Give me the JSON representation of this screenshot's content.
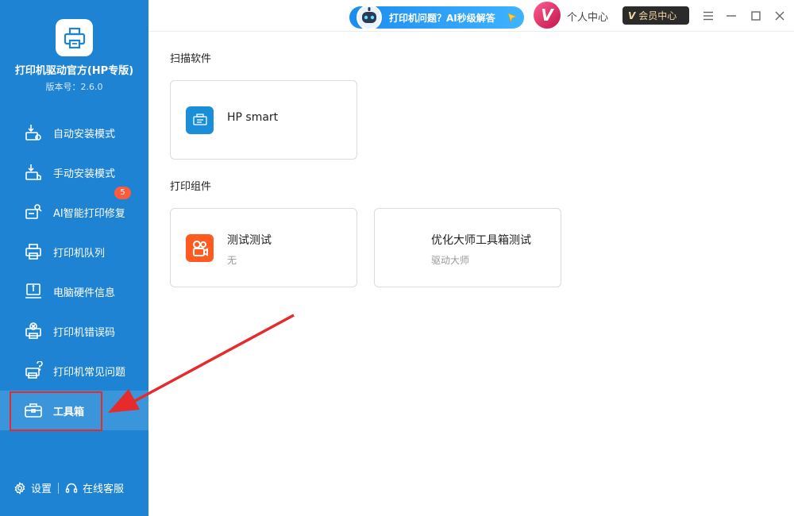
{
  "app": {
    "title": "打印机驱动官方(HP专版)",
    "version": "版本号：2.6.0"
  },
  "nav": {
    "items": [
      {
        "label": "自动安装模式",
        "icon": "auto-install-icon"
      },
      {
        "label": "手动安装模式",
        "icon": "manual-install-icon"
      },
      {
        "label": "AI智能打印修复",
        "icon": "ai-repair-icon",
        "badge": "5"
      },
      {
        "label": "打印机队列",
        "icon": "printer-queue-icon"
      },
      {
        "label": "电脑硬件信息",
        "icon": "hardware-info-icon"
      },
      {
        "label": "打印机错误码",
        "icon": "error-code-icon"
      },
      {
        "label": "打印机常见问题",
        "icon": "faq-icon"
      },
      {
        "label": "工具箱",
        "icon": "toolbox-icon",
        "active": true
      }
    ]
  },
  "footer": {
    "settings": "设置",
    "support": "在线客服"
  },
  "topbar": {
    "ai_banner": "打印机问题？AI秒级解答",
    "personal_center": "个人中心",
    "vip_center": "会员中心",
    "avatar_letter": "V",
    "vip_mark": "V"
  },
  "content": {
    "scan_section": {
      "title": "扫描软件",
      "cards": [
        {
          "name": "HP smart",
          "icon": "hp-smart-icon"
        }
      ]
    },
    "print_section": {
      "title": "打印组件",
      "cards": [
        {
          "name": "测试测试",
          "sub": "无",
          "icon": "kuaishou-icon"
        },
        {
          "name": "优化大师工具箱测试",
          "sub": "驱动大师"
        }
      ]
    }
  },
  "colors": {
    "sidebar_bg": "#1e83d2",
    "active_item_bg": "#3a95db",
    "badge": "#ff5a3c",
    "highlight": "#e52b2b"
  }
}
